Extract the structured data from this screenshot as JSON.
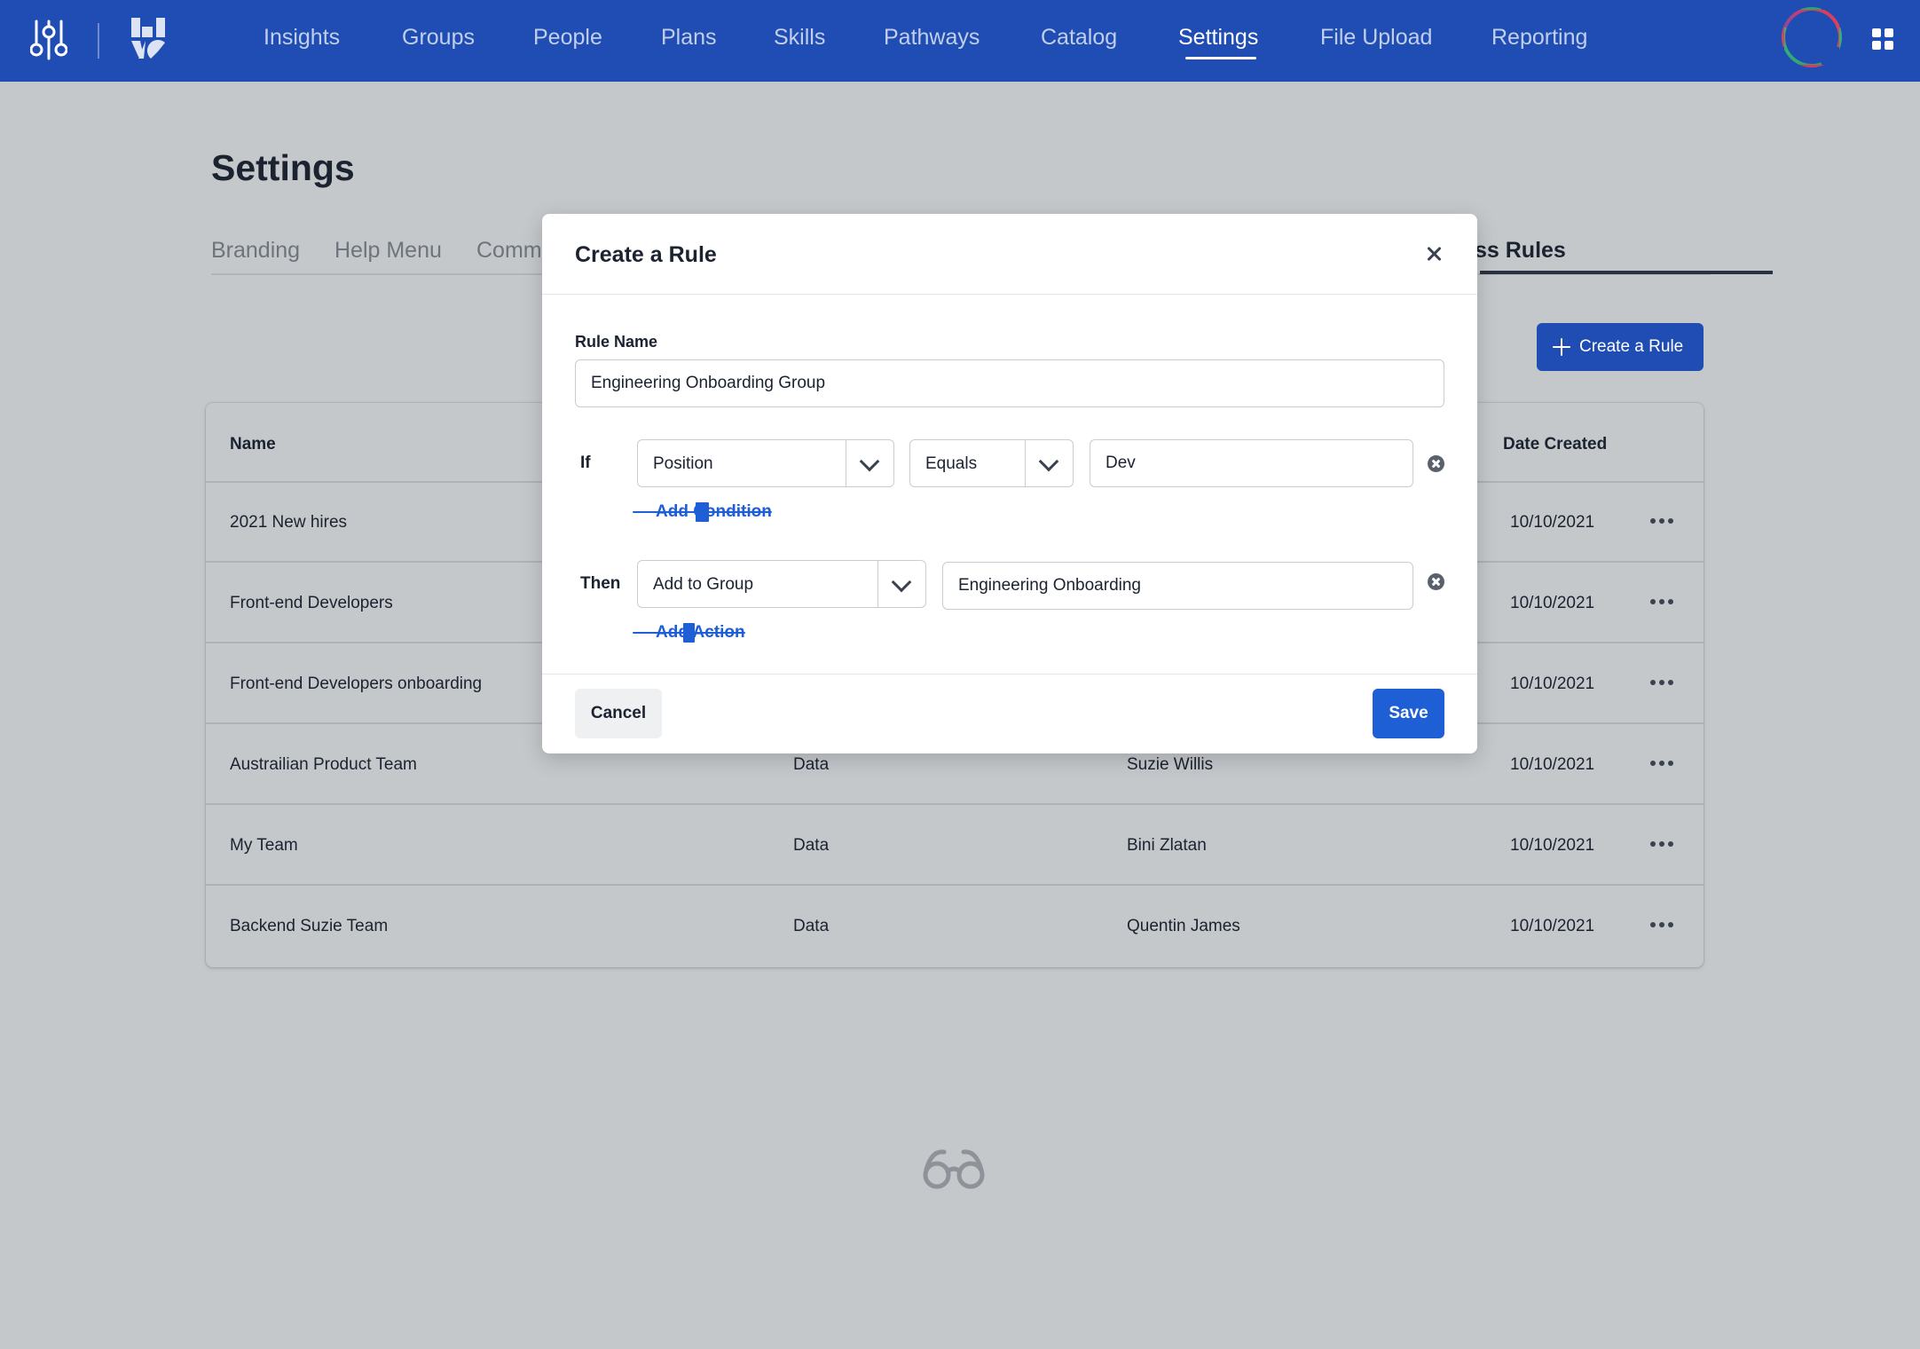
{
  "nav": {
    "links": [
      "Insights",
      "Groups",
      "People",
      "Plans",
      "Skills",
      "Pathways",
      "Catalog",
      "Settings",
      "File Upload",
      "Reporting"
    ],
    "active": "Settings",
    "icons": {
      "tools": "sliders-icon",
      "logo": "app-logo",
      "avatar": "avatar",
      "apps": "app-grid-icon"
    },
    "colors": {
      "bar": "#1f4db3",
      "inactive_link": "#c2cfeb",
      "active_link": "#ffffff"
    }
  },
  "page": {
    "title": "Settings",
    "tabs": [
      "Branding",
      "Help Menu",
      "Comm",
      "ss Rules"
    ],
    "active_tab": "ss Rules",
    "create_rule_label": "Create a Rule"
  },
  "table": {
    "columns": [
      "Name",
      "Date Created"
    ],
    "rows": [
      {
        "name": "2021 New hires",
        "type": "",
        "owner": "",
        "date": "10/10/2021"
      },
      {
        "name": "Front-end Developers",
        "type": "",
        "owner": "",
        "date": "10/10/2021"
      },
      {
        "name": "Front-end Developers onboarding",
        "type": "",
        "owner": "",
        "date": "10/10/2021"
      },
      {
        "name": "Austrailian Product Team",
        "type": "Data",
        "owner": "Suzie Willis",
        "date": "10/10/2021"
      },
      {
        "name": "My Team",
        "type": "Data",
        "owner": "Bini Zlatan",
        "date": "10/10/2021"
      },
      {
        "name": "Backend Suzie Team",
        "type": "Data",
        "owner": "Quentin James",
        "date": "10/10/2021"
      }
    ]
  },
  "modal": {
    "title": "Create a Rule",
    "rule_name_label": "Rule Name",
    "rule_name_value": "Engineering Onboarding Group",
    "if_label": "If",
    "if_field": "Position",
    "if_operator": "Equals",
    "if_value": "Dev",
    "add_condition_label": "Add Condition",
    "then_label": "Then",
    "then_action": "Add to Group",
    "then_value": "Engineering Onboarding",
    "add_action_label": "Add Action",
    "cancel_label": "Cancel",
    "save_label": "Save",
    "colors": {
      "primary": "#1f5fd6"
    }
  }
}
